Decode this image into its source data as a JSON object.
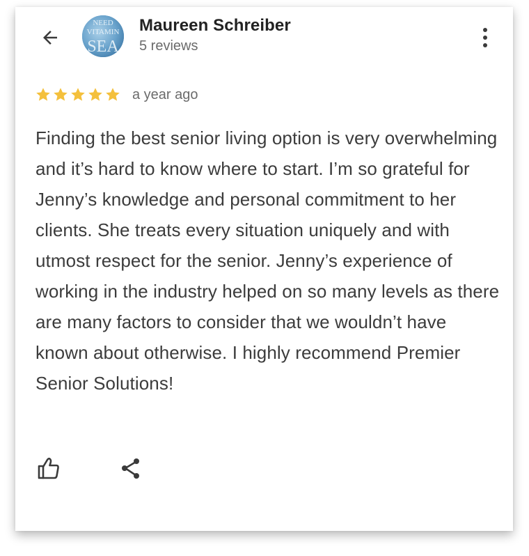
{
  "reviewer": {
    "name": "Maureen Schreiber",
    "review_count": "5 reviews",
    "avatar_text": {
      "line1": "NEED",
      "line2": "VITAMIN",
      "line3": "SEA"
    }
  },
  "review": {
    "rating": 5,
    "rating_max": 5,
    "date": "a year ago",
    "text": "Finding the best senior living option is very overwhelming and it’s hard to know where to start. I’m so grateful for Jenny’s knowledge and personal commitment to her clients. She treats every situation uniquely and with utmost respect for the senior. Jenny’s experience of working in the industry helped on so many levels as there are many factors to consider that we wouldn’t have known about otherwise. I highly recommend Premier Senior Solutions!"
  },
  "icons": {
    "back": "arrow-left-icon",
    "more": "more-vertical-icon",
    "star": "star-icon",
    "like": "thumbs-up-icon",
    "share": "share-icon"
  },
  "colors": {
    "star": "#f4c03c",
    "name": "#222222",
    "secondary_text": "#6b6b6b",
    "body_text": "#3c3c3c",
    "icon": "#3a3a3a"
  }
}
